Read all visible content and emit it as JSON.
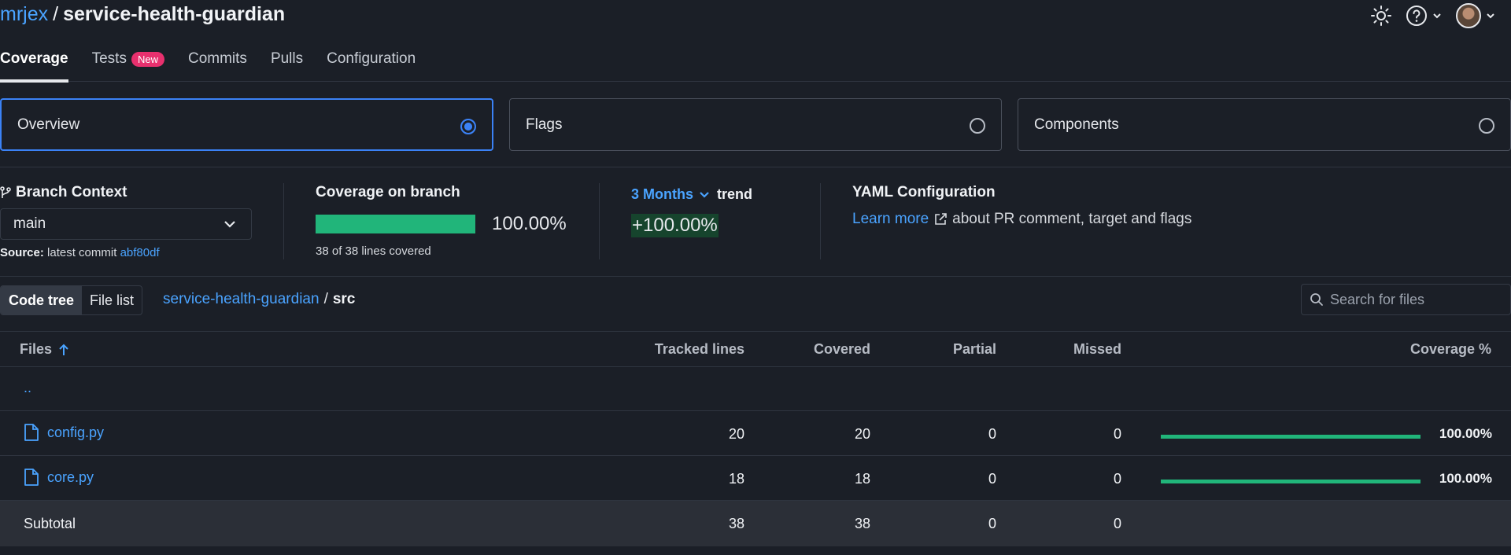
{
  "header": {
    "owner": "mrjex",
    "separator": "/",
    "repo": "service-health-guardian"
  },
  "tabs": [
    {
      "label": "Coverage",
      "active": true
    },
    {
      "label": "Tests",
      "badge": "New"
    },
    {
      "label": "Commits"
    },
    {
      "label": "Pulls"
    },
    {
      "label": "Configuration"
    }
  ],
  "views": [
    {
      "label": "Overview",
      "selected": true
    },
    {
      "label": "Flags",
      "selected": false
    },
    {
      "label": "Components",
      "selected": false
    }
  ],
  "branch_context": {
    "label": "Branch Context",
    "selected": "main",
    "source_label": "Source:",
    "source_text": "latest commit",
    "commit": "abf80df"
  },
  "coverage": {
    "label": "Coverage on branch",
    "value": "100.00%",
    "fraction": 1.0,
    "lines": "38 of 38 lines covered"
  },
  "trend": {
    "period": "3 Months",
    "word": "trend",
    "value": "+100.00%"
  },
  "yaml": {
    "label": "YAML Configuration",
    "link": "Learn more",
    "text": "about PR comment, target and flags"
  },
  "toolbar": {
    "code_tree": "Code tree",
    "file_list": "File list",
    "crumb_root": "service-health-guardian",
    "crumb_sep": "/",
    "crumb_current": "src",
    "search_placeholder": "Search for files"
  },
  "table": {
    "headers": {
      "files": "Files",
      "tracked": "Tracked lines",
      "covered": "Covered",
      "partial": "Partial",
      "missed": "Missed",
      "coverage": "Coverage %"
    },
    "updir": "..",
    "rows": [
      {
        "name": "config.py",
        "tracked": "20",
        "covered": "20",
        "partial": "0",
        "missed": "0",
        "coverage": "100.00%",
        "fraction": 1.0
      },
      {
        "name": "core.py",
        "tracked": "18",
        "covered": "18",
        "partial": "0",
        "missed": "0",
        "coverage": "100.00%",
        "fraction": 1.0
      }
    ],
    "subtotal": {
      "label": "Subtotal",
      "tracked": "38",
      "covered": "38",
      "partial": "0",
      "missed": "0"
    }
  },
  "colors": {
    "accent": "#4aa3ff",
    "selected_border": "#3b82f6",
    "coverage_green": "#21b57a",
    "badge_pink": "#e8306e"
  }
}
